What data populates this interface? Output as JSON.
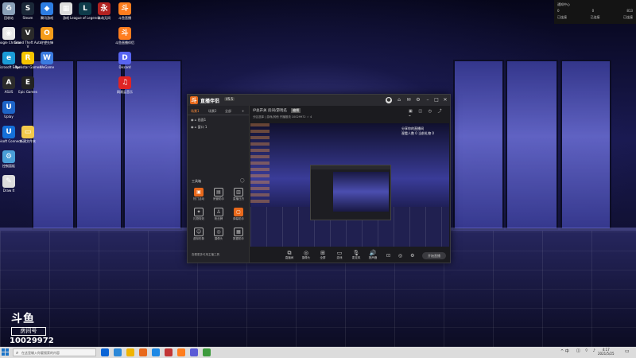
{
  "desktop": {
    "icons": [
      {
        "label": "回收站",
        "color": "#8aa0b8",
        "glyph": "♻"
      },
      {
        "label": "Steam",
        "color": "#1b2838",
        "glyph": "S"
      },
      {
        "label": "腾讯游戏",
        "color": "#2d7de3",
        "glyph": "◆"
      },
      {
        "label": "游戏",
        "color": "#dddddd",
        "glyph": "▦"
      },
      {
        "label": "League of Legends",
        "color": "#0e3b4a",
        "glyph": "L"
      },
      {
        "label": "永劫无间",
        "color": "#b22222",
        "glyph": "永"
      },
      {
        "label": "斗鱼直播",
        "color": "#ff7d1e",
        "glyph": "斗"
      },
      {
        "label": "Google Chrome",
        "color": "#e8e8e8",
        "glyph": "◉"
      },
      {
        "label": "Grand Theft Auto V",
        "color": "#2a2a2a",
        "glyph": "V"
      },
      {
        "label": "守望先锋",
        "color": "#f59c1a",
        "glyph": "O"
      },
      {
        "label": "斗鱼直播伴侣",
        "color": "#ff7d1e",
        "glyph": "斗"
      },
      {
        "label": "Microsoft Edge",
        "color": "#1b9bd7",
        "glyph": "e"
      },
      {
        "label": "Rockstar Games",
        "color": "#f5c400",
        "glyph": "R"
      },
      {
        "label": "WeGame",
        "color": "#3b7be0",
        "glyph": "W"
      },
      {
        "label": "Discord",
        "color": "#5865f2",
        "glyph": "D"
      },
      {
        "label": "ASUS",
        "color": "#2b2b2b",
        "glyph": "A"
      },
      {
        "label": "Epic Games",
        "color": "#222222",
        "glyph": "E"
      },
      {
        "label": "网易云音乐",
        "color": "#e02424",
        "glyph": "♫"
      },
      {
        "label": "Uplay",
        "color": "#1e64c8",
        "glyph": "U"
      },
      {
        "label": "Ubisoft Connect",
        "color": "#1570d8",
        "glyph": "U"
      },
      {
        "label": "新建文件夹",
        "color": "#f2c94c",
        "glyph": "▭"
      },
      {
        "label": "控制面板",
        "color": "#4a9fd8",
        "glyph": "⚙"
      },
      {
        "label": "Draw It",
        "color": "#dddddd",
        "glyph": "✎"
      }
    ]
  },
  "notification": {
    "title": "通知中心",
    "items": [
      "0",
      "0",
      "813"
    ],
    "line2": [
      "已连接",
      "已连接",
      "已连接"
    ]
  },
  "window": {
    "app_title": "直播伴侣",
    "version": "V5.5",
    "title_icons": [
      "avatar-icon",
      "shirt-icon",
      "mail-icon",
      "settings-icon",
      "minimize-icon",
      "maximize-icon",
      "close-icon"
    ],
    "left_tabs": [
      "场景1",
      "场景2",
      "全部"
    ],
    "scenes": [
      "画面1",
      "窗口 1"
    ],
    "tools_title": "工具箱",
    "tools": [
      {
        "label": "热门活动",
        "glyph": "▣",
        "orange": true
      },
      {
        "label": "房管助手",
        "glyph": "▤",
        "orange": false
      },
      {
        "label": "直播日历",
        "glyph": "▥",
        "orange": false
      },
      {
        "label": "礼物特效",
        "glyph": "✦",
        "orange": false
      },
      {
        "label": "粉丝牌",
        "glyph": "♙",
        "orange": false
      },
      {
        "label": "弹幕助手",
        "glyph": "▢",
        "orange": true
      },
      {
        "label": "虚拟形象",
        "glyph": "☺",
        "orange": false
      },
      {
        "label": "摄像头",
        "glyph": "◎",
        "orange": false
      },
      {
        "label": "数据助手",
        "glyph": "▦",
        "orange": false
      }
    ],
    "tools_more": "查看更多可用主播工具",
    "room_title": "IP总开关 房间/游戏名",
    "room_badge": "编辑",
    "room_row": "分区选择 | 游戏/其他   开播推流   10029972   ☆ 4",
    "overlay_lines": [
      "分享你的直播间",
      "观看人数 0 当前礼物 0"
    ],
    "bottom_buttons": [
      {
        "label": "直播间",
        "glyph": "⧉"
      },
      {
        "label": "摄像头",
        "glyph": "◎"
      },
      {
        "label": "全屏",
        "glyph": "⊞"
      },
      {
        "label": "游戏",
        "glyph": "▭"
      },
      {
        "label": "麦克风",
        "glyph": "🎙"
      },
      {
        "label": "扬声器",
        "glyph": "🔊"
      }
    ],
    "start_label": "开始直播"
  },
  "watermark": {
    "logo": "斗鱼",
    "room_label": "房间号",
    "room_number": "10029972"
  },
  "taskbar": {
    "search_placeholder": "在这里输入你要搜索的内容",
    "apps": [
      "#0a64d6",
      "#2b88d8",
      "#f0b400",
      "#e8691c",
      "#1d88e5",
      "#c23535",
      "#ff7d1e",
      "#5b5bd6",
      "#3d9b3d"
    ],
    "tray": "^ 中",
    "time": "4:17",
    "date": "2021/5/25"
  }
}
